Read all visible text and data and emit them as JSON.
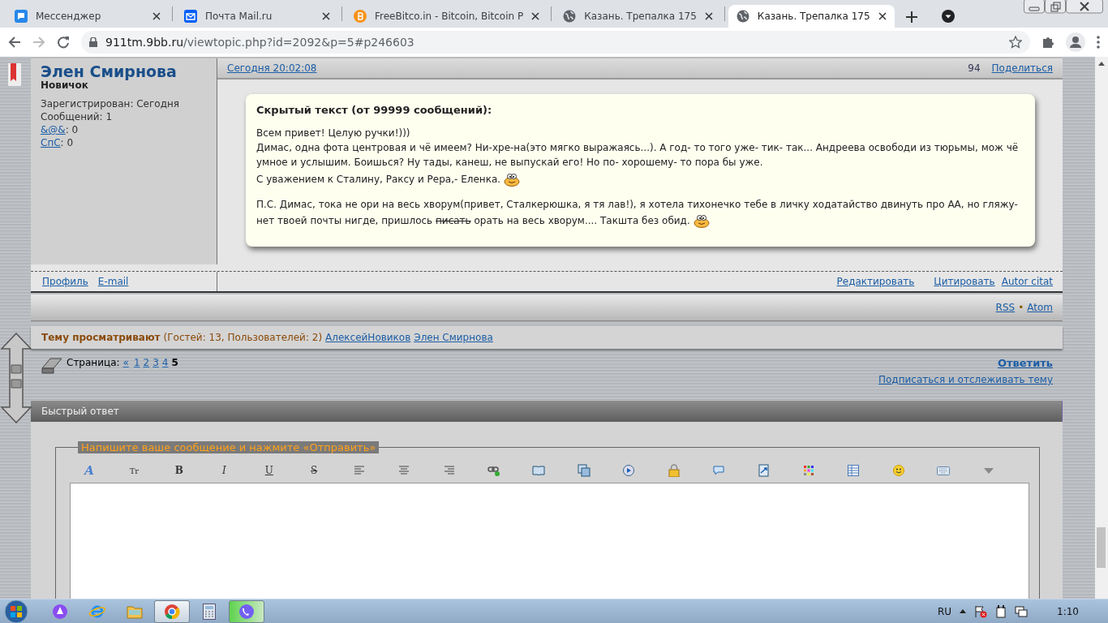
{
  "browser": {
    "tabs": [
      {
        "title": "Мессенджер",
        "kind": "chat",
        "selected": false
      },
      {
        "title": "Почта Mail.ru",
        "kind": "mail",
        "selected": false
      },
      {
        "title": "FreeBitco.in - Bitcoin, Bitcoin P",
        "kind": "coin",
        "selected": false
      },
      {
        "title": "Казань. Трепалка 175",
        "kind": "globe",
        "selected": false
      },
      {
        "title": "Казань. Трепалка 175",
        "kind": "globe",
        "selected": true
      }
    ],
    "url": {
      "host": "911tm.9bb.ru",
      "path": "/viewtopic.php?id=2092&p=5#p246603"
    }
  },
  "post": {
    "author": {
      "name": "Элен Смирнова",
      "rank": "Новичок",
      "stats": [
        {
          "text": "Зарегистрирован: Сегодня"
        },
        {
          "text": "Сообщений: 1"
        },
        {
          "link": "&@&",
          "text": ": 0"
        },
        {
          "link": "СпС",
          "text": ": 0"
        }
      ],
      "links": [
        "Профиль",
        "E-mail"
      ]
    },
    "date": "Сегодня 20:02:08",
    "number": "94",
    "share": "Поделиться",
    "message": {
      "title": "Скрытый текст (от 99999 сообщений):",
      "paragraphs": [
        {
          "segments": [
            {
              "text": "Всем привет! Целую ручки!)))",
              "struck": false
            }
          ],
          "smiley": false
        },
        {
          "segments": [
            {
              "text": "Димас, одна фота центровая и чё имеем? Ни-хре-на(это мягко выражаясь...). А год- то того уже- тик- так... Андреева освободи из тюрьмы, мож чё умное и услышим. Боишься? Ну тады, канеш, не выпускай его! Но по- хорошему- то пора бы уже.",
              "struck": false
            }
          ],
          "smiley": false
        },
        {
          "segments": [
            {
              "text": "С уважением к Сталину, Раксу и Рера,- Еленка.",
              "struck": false
            }
          ],
          "smiley": true
        },
        {
          "segments": [
            {
              "text": "П.С. Димас, тока не ори на весь хворум(привет, Сталкерюшка, я тя лав!), я хотела тихонечко тебе в личку ходатайство двинуть про АА, но гляжу- нет твоей почты нигде, пришлось ",
              "struck": false
            },
            {
              "text": "писать",
              "struck": true
            },
            {
              "text": " орать на весь хворум.... Такшта без обид.",
              "struck": false
            }
          ],
          "smiley": true
        }
      ]
    },
    "actions": [
      "Редактировать",
      "Цитировать",
      "Autor citat"
    ]
  },
  "feeds": {
    "links": [
      "RSS",
      "Atom"
    ],
    "separator": "•"
  },
  "viewers": {
    "label": "Тему просматривают",
    "counts": "(Гостей: 13, Пользователей: 2)",
    "users": [
      "АлексейНовиков",
      "Элен Смирнова"
    ]
  },
  "pagination": {
    "label": "Страница:",
    "prev": "«",
    "pages": [
      {
        "label": "1",
        "selected": false
      },
      {
        "label": "2",
        "selected": false
      },
      {
        "label": "3",
        "selected": false
      },
      {
        "label": "4",
        "selected": false
      },
      {
        "label": "5",
        "selected": true
      }
    ],
    "reply": "Ответить",
    "subscribe": "Подписаться и отслеживать тему"
  },
  "quick_reply": {
    "title": "Быстрый ответ",
    "legend": "Напишите ваше сообщение и нажмите «Отправить»",
    "toolbar": [
      {
        "kind": "glyph",
        "label": "A"
      },
      {
        "kind": "glyph",
        "label": "Tr"
      },
      {
        "kind": "glyph",
        "label": "B"
      },
      {
        "kind": "glyph",
        "label": "I"
      },
      {
        "kind": "glyph",
        "label": "U"
      },
      {
        "kind": "glyph",
        "label": "S"
      },
      {
        "kind": "align-left"
      },
      {
        "kind": "align-center"
      },
      {
        "kind": "align-right"
      },
      {
        "kind": "link"
      },
      {
        "kind": "book"
      },
      {
        "kind": "picture"
      },
      {
        "kind": "video"
      },
      {
        "kind": "lock"
      },
      {
        "kind": "speech"
      },
      {
        "kind": "document"
      },
      {
        "kind": "palette"
      },
      {
        "kind": "table"
      },
      {
        "kind": "smiley"
      },
      {
        "kind": "keyboard"
      },
      {
        "kind": "more"
      }
    ]
  },
  "taskbar": {
    "apps": [
      {
        "kind": "assistant",
        "selected": false
      },
      {
        "kind": "browser-e",
        "selected": false
      },
      {
        "kind": "folder",
        "selected": false
      },
      {
        "kind": "chrome",
        "selected": true
      },
      {
        "kind": "calculator",
        "selected": false
      },
      {
        "kind": "viber",
        "selected": true
      }
    ],
    "language": "RU",
    "time": "1:10"
  }
}
